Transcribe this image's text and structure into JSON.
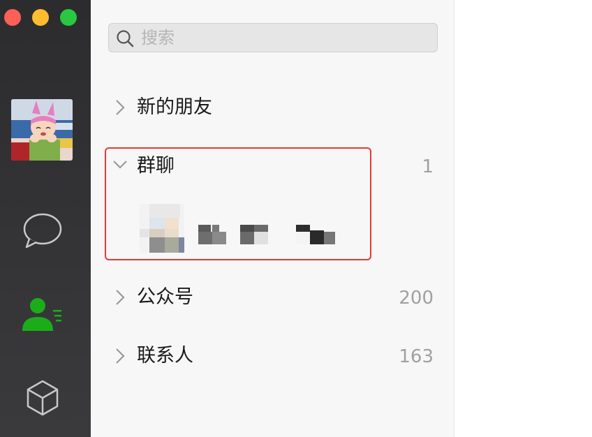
{
  "window": {
    "controls": [
      "close",
      "minimize",
      "zoom"
    ]
  },
  "sidebar": {
    "items": [
      {
        "icon": "chat-bubble-icon",
        "active": false
      },
      {
        "icon": "contacts-icon",
        "active": true
      },
      {
        "icon": "mini-program-cube-icon",
        "active": false
      }
    ],
    "active_color": "#1aad19"
  },
  "search": {
    "placeholder": "搜索",
    "value": ""
  },
  "contacts": {
    "sections": [
      {
        "label": "新的朋友",
        "count": "",
        "expanded": false
      },
      {
        "label": "群聊",
        "count": "1",
        "expanded": true
      },
      {
        "label": "公众号",
        "count": "200",
        "expanded": false
      },
      {
        "label": "联系人",
        "count": "163",
        "expanded": false
      }
    ]
  },
  "colors": {
    "highlight_border": "#e53935",
    "sidebar_bg": "#2c2c2e",
    "panel_bg": "#f7f7f7"
  }
}
